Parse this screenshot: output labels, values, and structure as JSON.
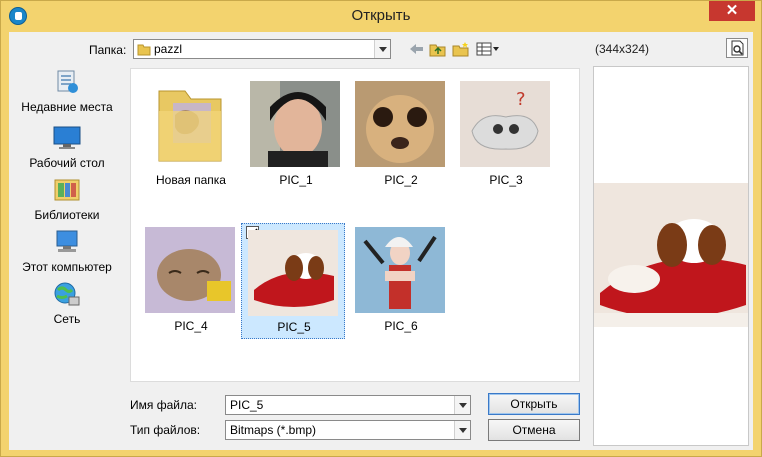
{
  "window": {
    "title": "Открыть",
    "close_glyph": "✕"
  },
  "toolbar": {
    "look_in_label": "Папка:",
    "folder_value": "pazzl",
    "image_dims": "(344x324)"
  },
  "places": [
    {
      "label": "Недавние места",
      "icon": "recent-places-icon"
    },
    {
      "label": "Рабочий стол",
      "icon": "desktop-icon"
    },
    {
      "label": "Библиотеки",
      "icon": "libraries-icon"
    },
    {
      "label": "Этот компьютер",
      "icon": "computer-icon"
    },
    {
      "label": "Сеть",
      "icon": "network-icon"
    }
  ],
  "files": [
    {
      "name": "Новая папка",
      "kind": "folder"
    },
    {
      "name": "PIC_1",
      "kind": "image"
    },
    {
      "name": "PIC_2",
      "kind": "image"
    },
    {
      "name": "PIC_3",
      "kind": "image"
    },
    {
      "name": "PIC_4",
      "kind": "image"
    },
    {
      "name": "PIC_5",
      "kind": "image",
      "selected": true
    },
    {
      "name": "PIC_6",
      "kind": "image"
    }
  ],
  "form": {
    "filename_label": "Имя файла:",
    "filename_value": "PIC_5",
    "filetype_label": "Тип файлов:",
    "filetype_value": "Bitmaps (*.bmp)",
    "open_button": "Открыть",
    "cancel_button": "Отмена"
  },
  "colors": {
    "frame": "#f3d36e",
    "close": "#c7372f",
    "selection": "#cce8ff"
  }
}
